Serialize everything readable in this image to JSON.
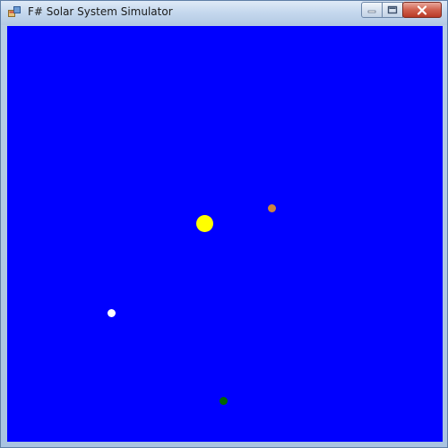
{
  "window": {
    "title": "F# Solar System Simulator",
    "icon": "app-window-icon",
    "controls": {
      "minimize_icon": "minimize-icon",
      "maximize_icon": "maximize-icon",
      "close_icon": "close-icon"
    }
  },
  "canvas": {
    "background_color": "#0000ff",
    "bodies": [
      {
        "name": "sun",
        "color": "#ffff00"
      },
      {
        "name": "planet-orange",
        "color": "#cd853f"
      },
      {
        "name": "planet-white",
        "color": "#ffffff"
      },
      {
        "name": "planet-green",
        "color": "#006400"
      }
    ]
  }
}
